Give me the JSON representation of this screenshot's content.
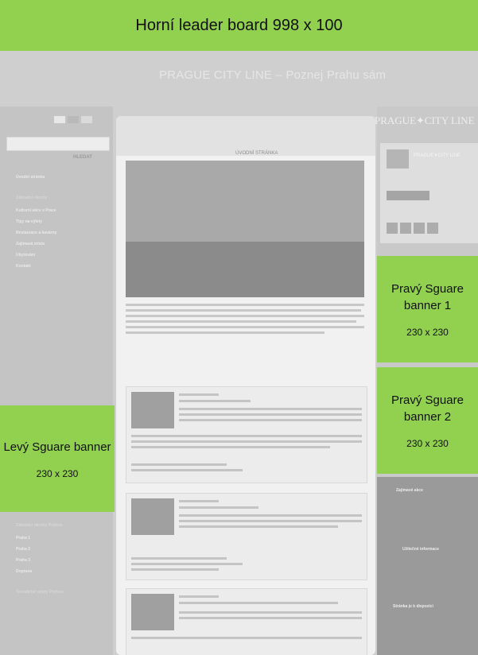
{
  "top_banner": {
    "label": "Horní leader board  998 x 100"
  },
  "site": {
    "title": "PRAGUE CITY LINE – Poznej Prahu sám",
    "brand": "PRAGUE✦CITY LINE",
    "search_button": "HLEDAT",
    "home_label": "ÚVODNÍ STRÁNKA",
    "left_nav": [
      {
        "label": "Úvodní stránka"
      },
      {
        "label": "Základní okruhy"
      },
      {
        "label": "Kulturní akce v Praze"
      },
      {
        "label": "Tipy na výlety"
      },
      {
        "label": "Restaurace a kavárny"
      },
      {
        "label": "Zajímavá místa"
      },
      {
        "label": "Ubytování"
      },
      {
        "label": "Kontakt"
      }
    ],
    "left_nav_lower": [
      {
        "label": "Základní okruhy Prahou"
      },
      {
        "label": "Praha 1"
      },
      {
        "label": "Praha 2"
      },
      {
        "label": "Praha 3"
      },
      {
        "label": "Doprava"
      },
      {
        "label": "Tematické výlety Prahou"
      }
    ],
    "right_links": [
      {
        "label": "Zajímavé akce"
      },
      {
        "label": "Užitečné informace"
      },
      {
        "label": "Stránka je k dispozici"
      }
    ]
  },
  "ads": {
    "left": {
      "title": "Levý  Sguare banner",
      "size": "230 x 230"
    },
    "right_1": {
      "title": "Pravý  Sguare banner 1",
      "size": "230 x 230"
    },
    "right_2": {
      "title": "Pravý  Sguare banner 2",
      "size": "230 x 230"
    }
  },
  "colors": {
    "placeholder_green": "#92d050",
    "site_gray": "#cfcfcf"
  }
}
